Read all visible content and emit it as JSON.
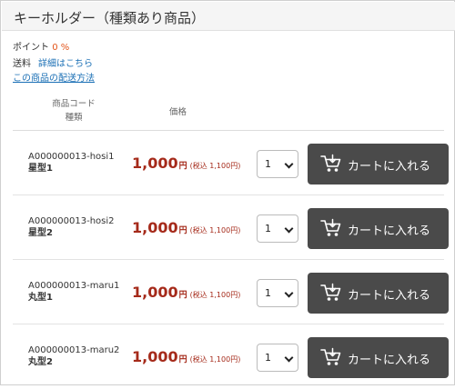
{
  "header": {
    "title": "キーホルダー（種類あり商品）"
  },
  "point": {
    "label": "ポイント",
    "value": "0 %"
  },
  "shipping": {
    "label": "送料",
    "detail_link": "詳細はこちら",
    "method_link": "この商品の配送方法"
  },
  "table": {
    "col_code_line1": "商品コード",
    "col_code_line2": "種類",
    "col_price": "価格"
  },
  "colors": {
    "price": "#a52a1a",
    "point": "#e2541a",
    "link": "#1a6fb5",
    "cart_button": "#4a4a4a"
  },
  "icons": {
    "cart": "cart-icon",
    "select": "chevron-down-icon"
  },
  "rows": [
    {
      "code": "A000000013-hosi1",
      "name": "星型1",
      "price": "1,000",
      "yen": "円",
      "tax": "(税込 1,100円)",
      "qty": "1",
      "button": "カートに入れる"
    },
    {
      "code": "A000000013-hosi2",
      "name": "星型2",
      "price": "1,000",
      "yen": "円",
      "tax": "(税込 1,100円)",
      "qty": "1",
      "button": "カートに入れる"
    },
    {
      "code": "A000000013-maru1",
      "name": "丸型1",
      "price": "1,000",
      "yen": "円",
      "tax": "(税込 1,100円)",
      "qty": "1",
      "button": "カートに入れる"
    },
    {
      "code": "A000000013-maru2",
      "name": "丸型2",
      "price": "1,000",
      "yen": "円",
      "tax": "(税込 1,100円)",
      "qty": "1",
      "button": "カートに入れる"
    }
  ]
}
